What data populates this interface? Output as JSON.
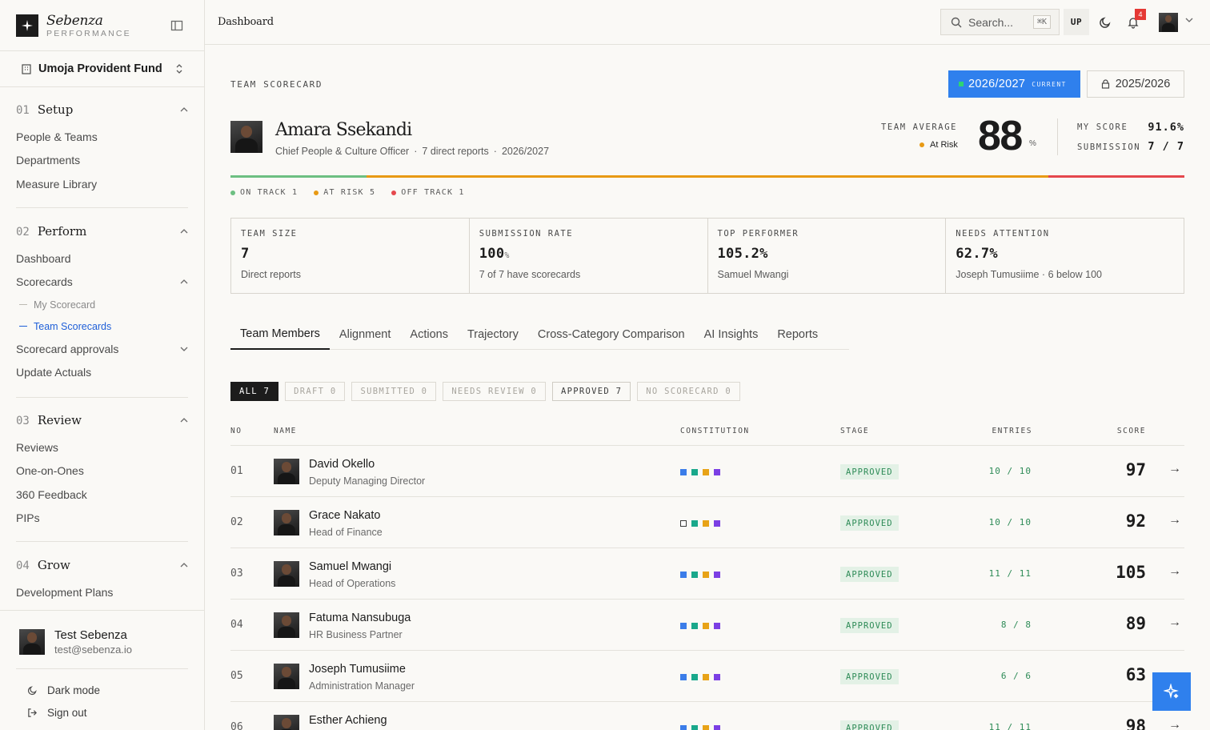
{
  "brand": {
    "name": "Sebenza",
    "sub": "PERFORMANCE"
  },
  "org": {
    "name": "Umoja Provident Fund"
  },
  "nav": {
    "setup": {
      "num": "01",
      "title": "Setup",
      "items": [
        "People & Teams",
        "Departments",
        "Measure Library"
      ]
    },
    "perform": {
      "num": "02",
      "title": "Perform",
      "items": [
        "Dashboard",
        "Scorecards",
        "Scorecard approvals",
        "Update Actuals"
      ],
      "sub_items": [
        "My Scorecard",
        "Team Scorecards"
      ]
    },
    "review": {
      "num": "03",
      "title": "Review",
      "items": [
        "Reviews",
        "One-on-Ones",
        "360 Feedback",
        "PIPs"
      ]
    },
    "grow": {
      "num": "04",
      "title": "Grow",
      "items": [
        "Development Plans"
      ]
    }
  },
  "user": {
    "name": "Test Sebenza",
    "email": "test@sebenza.io",
    "dark_mode": "Dark mode",
    "sign_out": "Sign out"
  },
  "topbar": {
    "breadcrumb": "Dashboard",
    "search_placeholder": "Search...",
    "search_kbd": "⌘K",
    "up": "UP",
    "notifications": "4"
  },
  "header": {
    "eyebrow": "TEAM SCORECARD",
    "year_current": "2026/2027",
    "year_current_tag": "CURRENT",
    "year_prev": "2025/2026"
  },
  "person": {
    "name": "Amara Ssekandi",
    "title": "Chief People & Culture Officer",
    "reports": "7 direct reports",
    "period": "2026/2027"
  },
  "summary": {
    "avg_label": "TEAM AVERAGE",
    "avg_status": "At Risk",
    "avg_value": "88",
    "avg_unit": "%",
    "my_score_label": "MY SCORE",
    "my_score": "91.6%",
    "submission_label": "SUBMISSION",
    "submission": "7 / 7"
  },
  "status_bar": {
    "on_track": 1,
    "at_risk": 5,
    "off_track": 1,
    "labels": [
      "ON TRACK 1",
      "AT RISK 5",
      "OFF TRACK 1"
    ],
    "colors": [
      "#6dbf82",
      "#e89a14",
      "#e5484d"
    ]
  },
  "stats": [
    {
      "label": "TEAM SIZE",
      "value": "7",
      "unit": "",
      "sub": "Direct reports"
    },
    {
      "label": "SUBMISSION RATE",
      "value": "100",
      "unit": "%",
      "sub": "7 of 7 have scorecards"
    },
    {
      "label": "TOP PERFORMER",
      "value": "105.2%",
      "unit": "",
      "sub": "Samuel Mwangi"
    },
    {
      "label": "NEEDS ATTENTION",
      "value": "62.7%",
      "unit": "",
      "sub": "Joseph Tumusiime · 6 below 100"
    }
  ],
  "tabs": [
    "Team Members",
    "Alignment",
    "Actions",
    "Trajectory",
    "Cross-Category Comparison",
    "AI Insights",
    "Reports"
  ],
  "filters": [
    "ALL 7",
    "DRAFT 0",
    "SUBMITTED 0",
    "NEEDS REVIEW 0",
    "APPROVED 7",
    "NO SCORECARD 0"
  ],
  "table": {
    "headers": [
      "NO",
      "NAME",
      "CONSTITUTION",
      "STAGE",
      "ENTRIES",
      "SCORE"
    ],
    "constitution_colors": [
      "#3b7de9",
      "#19a88b",
      "#e8a317",
      "#7b3fe4"
    ],
    "rows": [
      {
        "no": "01",
        "name": "David Okello",
        "role": "Deputy Managing Director",
        "stage": "APPROVED",
        "entries": "10 / 10",
        "score": "97",
        "first_hollow": false
      },
      {
        "no": "02",
        "name": "Grace Nakato",
        "role": "Head of Finance",
        "stage": "APPROVED",
        "entries": "10 / 10",
        "score": "92",
        "first_hollow": true
      },
      {
        "no": "03",
        "name": "Samuel Mwangi",
        "role": "Head of Operations",
        "stage": "APPROVED",
        "entries": "11 / 11",
        "score": "105",
        "first_hollow": false
      },
      {
        "no": "04",
        "name": "Fatuma Nansubuga",
        "role": "HR Business Partner",
        "stage": "APPROVED",
        "entries": "8 / 8",
        "score": "89",
        "first_hollow": false
      },
      {
        "no": "05",
        "name": "Joseph Tumusiime",
        "role": "Administration Manager",
        "stage": "APPROVED",
        "entries": "6 / 6",
        "score": "63",
        "first_hollow": false
      },
      {
        "no": "06",
        "name": "Esther Achieng",
        "role": "",
        "stage": "APPROVED",
        "entries": "11 / 11",
        "score": "98",
        "first_hollow": false
      }
    ]
  },
  "arrow_glyph": "→"
}
